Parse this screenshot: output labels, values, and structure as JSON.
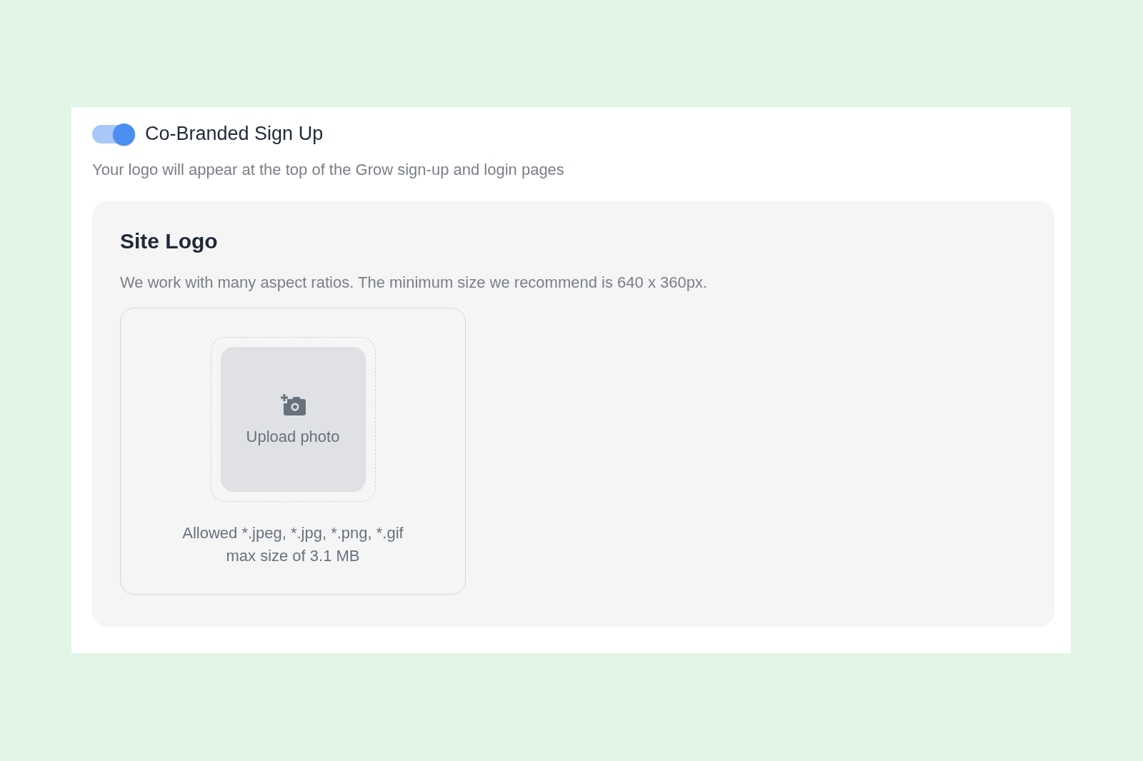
{
  "toggle": {
    "label": "Co-Branded Sign Up",
    "on": true
  },
  "description": "Your logo will appear at the top of the Grow sign-up and login pages",
  "site_logo": {
    "title": "Site Logo",
    "hint": "We work with many aspect ratios. The minimum size we recommend is 640 x 360px.",
    "upload": {
      "label": "Upload photo",
      "allowed": "Allowed *.jpeg, *.jpg, *.png, *.gif",
      "max_size": "max size of 3.1 MB"
    }
  }
}
